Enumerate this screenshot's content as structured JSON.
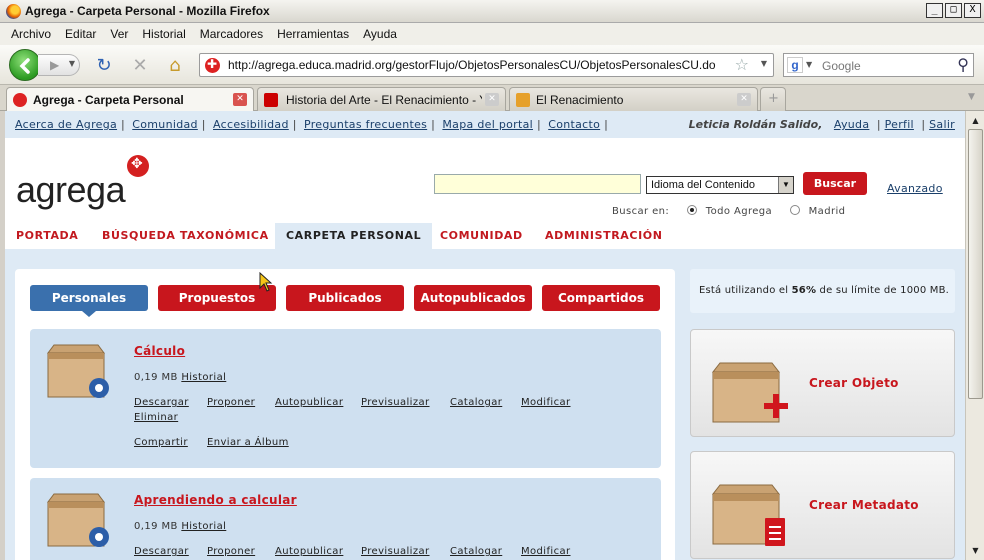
{
  "window": {
    "title": "Agrega - Carpeta Personal - Mozilla Firefox",
    "buttons": [
      "_",
      "□",
      "X"
    ]
  },
  "menubar": [
    "Archivo",
    "Editar",
    "Ver",
    "Historial",
    "Marcadores",
    "Herramientas",
    "Ayuda"
  ],
  "navbar": {
    "url": "http://agrega.educa.madrid.org/gestorFlujo/ObjetosPersonalesCU/ObjetosPersonalesCU.do",
    "search_placeholder": "Google",
    "search_engine_logo": "g"
  },
  "tabs": [
    {
      "label": "Agrega - Carpeta Personal",
      "icon": "agrega-icon",
      "active": true
    },
    {
      "label": "Historia del Arte - El Renacimiento - Yo...",
      "icon": "youtube-icon",
      "active": false
    },
    {
      "label": "El Renacimiento",
      "icon": "blog-icon",
      "active": false
    }
  ],
  "toplinks": {
    "left": [
      "Acerca de Agrega",
      "Comunidad",
      "Accesibilidad",
      "Preguntas frecuentes",
      "Mapa del portal",
      "Contacto"
    ],
    "user": "Leticia Roldán Salido,",
    "right": [
      "Ayuda",
      "Perfil",
      "Salir"
    ]
  },
  "logo": "agrega",
  "search": {
    "value": "",
    "language_select": "Idioma del Contenido",
    "button": "Buscar",
    "advanced": "Avanzado",
    "scope_label": "Buscar en:",
    "scope_options": [
      "Todo Agrega",
      "Madrid"
    ],
    "scope_selected": "Todo Agrega"
  },
  "mainnav": [
    "PORTADA",
    "BÚSQUEDA TAXONÓMICA",
    "CARPETA PERSONAL",
    "COMUNIDAD",
    "ADMINISTRACIÓN"
  ],
  "mainnav_active": "CARPETA PERSONAL",
  "folder_tabs": [
    "Personales",
    "Propuestos",
    "Publicados",
    "Autopublicados",
    "Compartidos"
  ],
  "folder_tab_active": "Personales",
  "objects": [
    {
      "title": "Cálculo",
      "size": "0,19 MB",
      "history": "Historial",
      "actions": [
        "Descargar",
        "Proponer",
        "Autopublicar",
        "Previsualizar",
        "Catalogar",
        "Modificar",
        "Eliminar"
      ],
      "actions2": [
        "Compartir",
        "Enviar a Álbum"
      ]
    },
    {
      "title": "Aprendiendo a calcular",
      "size": "0,19 MB",
      "history": "Historial",
      "actions": [
        "Descargar",
        "Proponer",
        "Autopublicar",
        "Previsualizar",
        "Catalogar",
        "Modificar"
      ]
    }
  ],
  "quota": {
    "prefix": "Está utilizando el ",
    "percent": "56%",
    "suffix": " de su límite de 1000 MB."
  },
  "sidebar_buttons": [
    "Crear Objeto",
    "Crear Metadato"
  ],
  "colors": {
    "brand_red": "#c8161d",
    "active_blue": "#3a70ad",
    "panel_blue": "#deeaf5",
    "card_blue": "#cfe0f0"
  }
}
